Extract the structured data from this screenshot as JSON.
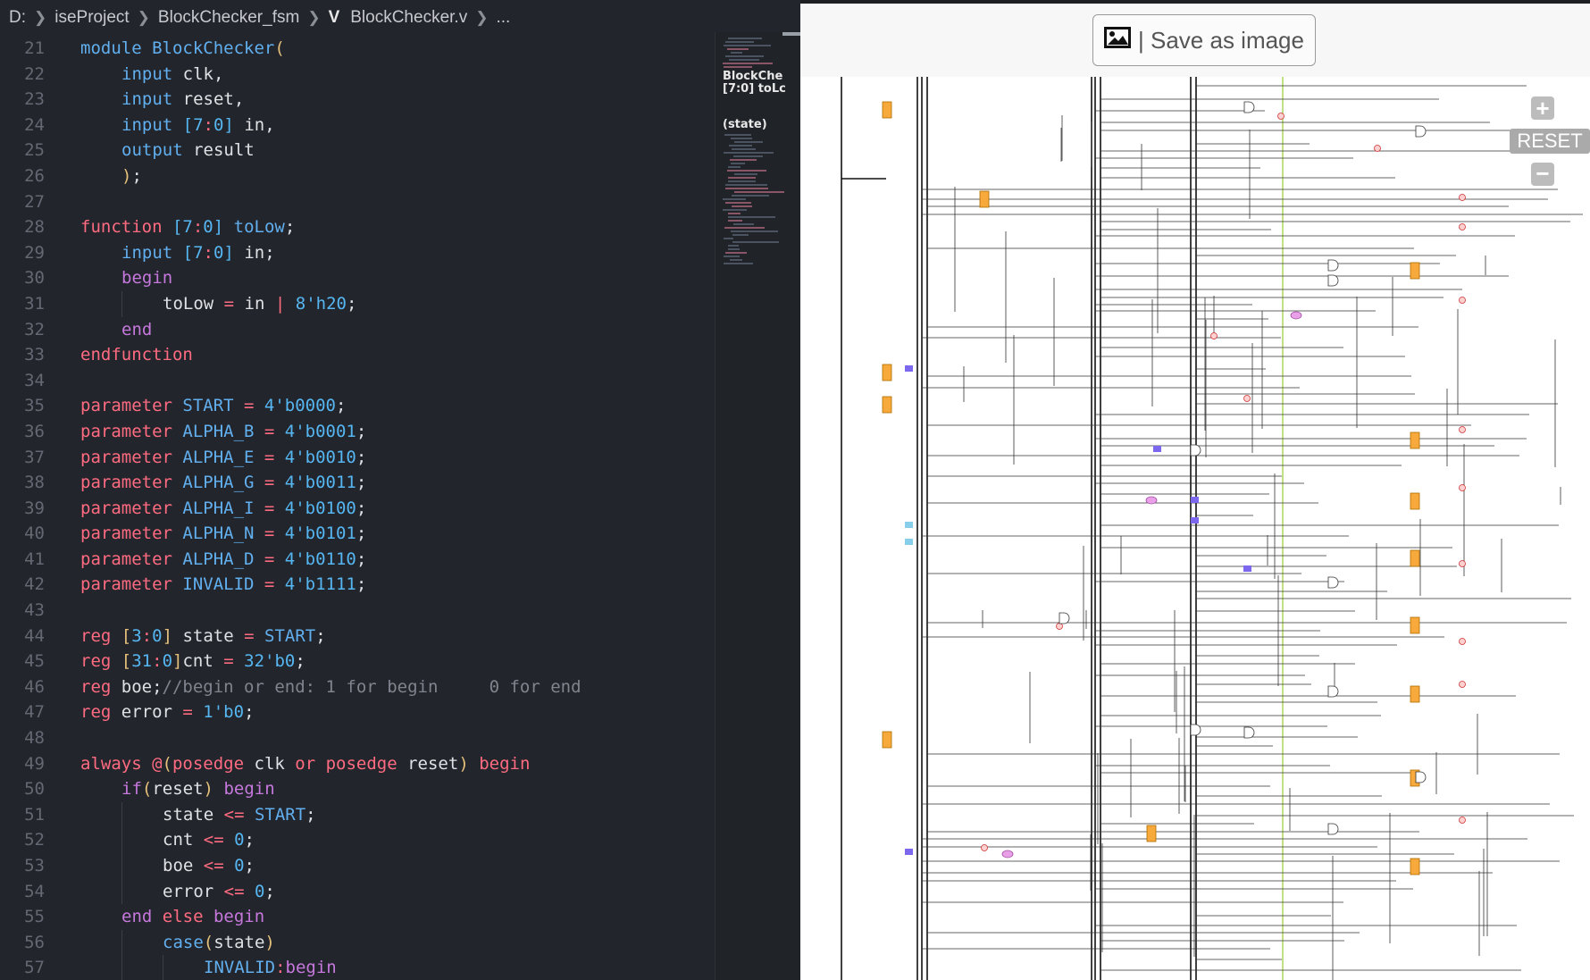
{
  "breadcrumb": {
    "items": [
      "D:",
      "iseProject",
      "BlockChecker_fsm"
    ],
    "file_icon": "V",
    "file": "BlockChecker.v",
    "tail": "..."
  },
  "code": {
    "lines": [
      {
        "n": "21",
        "i": 0,
        "t": [
          [
            "kw3",
            "module "
          ],
          [
            "fn",
            "BlockChecker"
          ],
          [
            "br",
            "("
          ]
        ]
      },
      {
        "n": "22",
        "i": 1,
        "t": [
          [
            "kw3",
            "input "
          ],
          [
            "",
            "clk,"
          ]
        ]
      },
      {
        "n": "23",
        "i": 1,
        "t": [
          [
            "kw3",
            "input "
          ],
          [
            "",
            "reset,"
          ]
        ]
      },
      {
        "n": "24",
        "i": 1,
        "t": [
          [
            "kw3",
            "input "
          ],
          [
            "num",
            "[7"
          ],
          [
            "op",
            ":"
          ],
          [
            "num",
            "0] "
          ],
          [
            "",
            "in,"
          ]
        ]
      },
      {
        "n": "25",
        "i": 1,
        "t": [
          [
            "kw3",
            "output "
          ],
          [
            "",
            "result"
          ]
        ]
      },
      {
        "n": "26",
        "i": 1,
        "t": [
          [
            "br",
            ")"
          ],
          [
            "",
            ";"
          ]
        ]
      },
      {
        "n": "27",
        "i": 0,
        "t": []
      },
      {
        "n": "28",
        "i": 0,
        "t": [
          [
            "kw2",
            "function "
          ],
          [
            "num",
            "[7"
          ],
          [
            "op",
            ":"
          ],
          [
            "num",
            "0] "
          ],
          [
            "fn",
            "toLow"
          ],
          [
            "",
            ";"
          ]
        ]
      },
      {
        "n": "29",
        "i": 1,
        "t": [
          [
            "kw3",
            "input "
          ],
          [
            "num",
            "[7"
          ],
          [
            "op",
            ":"
          ],
          [
            "num",
            "0] "
          ],
          [
            "",
            "in;"
          ]
        ]
      },
      {
        "n": "30",
        "i": 1,
        "t": [
          [
            "kw",
            "begin"
          ]
        ]
      },
      {
        "n": "31",
        "i": 2,
        "t": [
          [
            "",
            "toLow "
          ],
          [
            "op",
            "= "
          ],
          [
            "",
            "in "
          ],
          [
            "op",
            "| "
          ],
          [
            "num",
            "8'h20"
          ],
          [
            "",
            ";"
          ]
        ]
      },
      {
        "n": "32",
        "i": 1,
        "t": [
          [
            "kw",
            "end"
          ]
        ]
      },
      {
        "n": "33",
        "i": 0,
        "t": [
          [
            "kw2",
            "endfunction"
          ]
        ]
      },
      {
        "n": "34",
        "i": 0,
        "t": []
      },
      {
        "n": "35",
        "i": 0,
        "t": [
          [
            "kw2",
            "parameter "
          ],
          [
            "fn",
            "START "
          ],
          [
            "op",
            "= "
          ],
          [
            "num",
            "4'b0000"
          ],
          [
            "",
            ";"
          ]
        ]
      },
      {
        "n": "36",
        "i": 0,
        "t": [
          [
            "kw2",
            "parameter "
          ],
          [
            "fn",
            "ALPHA_B "
          ],
          [
            "op",
            "= "
          ],
          [
            "num",
            "4'b0001"
          ],
          [
            "",
            ";"
          ]
        ]
      },
      {
        "n": "37",
        "i": 0,
        "t": [
          [
            "kw2",
            "parameter "
          ],
          [
            "fn",
            "ALPHA_E "
          ],
          [
            "op",
            "= "
          ],
          [
            "num",
            "4'b0010"
          ],
          [
            "",
            ";"
          ]
        ]
      },
      {
        "n": "38",
        "i": 0,
        "t": [
          [
            "kw2",
            "parameter "
          ],
          [
            "fn",
            "ALPHA_G "
          ],
          [
            "op",
            "= "
          ],
          [
            "num",
            "4'b0011"
          ],
          [
            "",
            ";"
          ]
        ]
      },
      {
        "n": "39",
        "i": 0,
        "t": [
          [
            "kw2",
            "parameter "
          ],
          [
            "fn",
            "ALPHA_I "
          ],
          [
            "op",
            "= "
          ],
          [
            "num",
            "4'b0100"
          ],
          [
            "",
            ";"
          ]
        ]
      },
      {
        "n": "40",
        "i": 0,
        "t": [
          [
            "kw2",
            "parameter "
          ],
          [
            "fn",
            "ALPHA_N "
          ],
          [
            "op",
            "= "
          ],
          [
            "num",
            "4'b0101"
          ],
          [
            "",
            ";"
          ]
        ]
      },
      {
        "n": "41",
        "i": 0,
        "t": [
          [
            "kw2",
            "parameter "
          ],
          [
            "fn",
            "ALPHA_D "
          ],
          [
            "op",
            "= "
          ],
          [
            "num",
            "4'b0110"
          ],
          [
            "",
            ";"
          ]
        ]
      },
      {
        "n": "42",
        "i": 0,
        "t": [
          [
            "kw2",
            "parameter "
          ],
          [
            "fn",
            "INVALID "
          ],
          [
            "op",
            "= "
          ],
          [
            "num",
            "4'b1111"
          ],
          [
            "",
            ";"
          ]
        ]
      },
      {
        "n": "43",
        "i": 0,
        "t": []
      },
      {
        "n": "44",
        "i": 0,
        "t": [
          [
            "kw2",
            "reg "
          ],
          [
            "br",
            "["
          ],
          [
            "num",
            "3"
          ],
          [
            "op",
            ":"
          ],
          [
            "num",
            "0"
          ],
          [
            "br",
            "] "
          ],
          [
            "",
            "state "
          ],
          [
            "op",
            "= "
          ],
          [
            "fn",
            "START"
          ],
          [
            "",
            ";"
          ]
        ]
      },
      {
        "n": "45",
        "i": 0,
        "t": [
          [
            "kw2",
            "reg "
          ],
          [
            "br",
            "["
          ],
          [
            "num",
            "31"
          ],
          [
            "op",
            ":"
          ],
          [
            "num",
            "0"
          ],
          [
            "br",
            "]"
          ],
          [
            "",
            "cnt "
          ],
          [
            "op",
            "= "
          ],
          [
            "num",
            "32'b0"
          ],
          [
            "",
            ";"
          ]
        ]
      },
      {
        "n": "46",
        "i": 0,
        "t": [
          [
            "kw2",
            "reg "
          ],
          [
            "",
            "boe;"
          ],
          [
            "cm",
            "//begin or end: 1 for begin     0 for end"
          ]
        ]
      },
      {
        "n": "47",
        "i": 0,
        "t": [
          [
            "kw2",
            "reg "
          ],
          [
            "",
            "error "
          ],
          [
            "op",
            "= "
          ],
          [
            "num",
            "1'b0"
          ],
          [
            "",
            ";"
          ]
        ]
      },
      {
        "n": "48",
        "i": 0,
        "t": []
      },
      {
        "n": "49",
        "i": 0,
        "t": [
          [
            "kw2",
            "always "
          ],
          [
            "op",
            "@"
          ],
          [
            "br",
            "("
          ],
          [
            "kw2",
            "posedge "
          ],
          [
            "",
            "clk "
          ],
          [
            "kw2",
            "or "
          ],
          [
            "kw2",
            "posedge "
          ],
          [
            "",
            "reset"
          ],
          [
            "br",
            ") "
          ],
          [
            "kw2",
            "begin"
          ]
        ]
      },
      {
        "n": "50",
        "i": 1,
        "t": [
          [
            "kw",
            "if"
          ],
          [
            "br",
            "("
          ],
          [
            "",
            "reset"
          ],
          [
            "br",
            ") "
          ],
          [
            "kw",
            "begin"
          ]
        ]
      },
      {
        "n": "51",
        "i": 2,
        "t": [
          [
            "",
            "state "
          ],
          [
            "op",
            "<= "
          ],
          [
            "fn",
            "START"
          ],
          [
            "",
            ";"
          ]
        ]
      },
      {
        "n": "52",
        "i": 2,
        "t": [
          [
            "",
            "cnt "
          ],
          [
            "op",
            "<= "
          ],
          [
            "num",
            "0"
          ],
          [
            "",
            ";"
          ]
        ]
      },
      {
        "n": "53",
        "i": 2,
        "t": [
          [
            "",
            "boe "
          ],
          [
            "op",
            "<= "
          ],
          [
            "num",
            "0"
          ],
          [
            "",
            ";"
          ]
        ]
      },
      {
        "n": "54",
        "i": 2,
        "t": [
          [
            "",
            "error "
          ],
          [
            "op",
            "<= "
          ],
          [
            "num",
            "0"
          ],
          [
            "",
            ";"
          ]
        ]
      },
      {
        "n": "55",
        "i": 1,
        "t": [
          [
            "kw",
            "end "
          ],
          [
            "kw2",
            "else "
          ],
          [
            "kw",
            "begin"
          ]
        ]
      },
      {
        "n": "56",
        "i": 2,
        "t": [
          [
            "kw3",
            "case"
          ],
          [
            "br",
            "("
          ],
          [
            "",
            "state"
          ],
          [
            "br",
            ")"
          ]
        ]
      },
      {
        "n": "57",
        "i": 3,
        "t": [
          [
            "fn",
            "INVALID"
          ],
          [
            "op",
            ":"
          ],
          [
            "kw",
            "begin"
          ]
        ]
      }
    ]
  },
  "minimap": {
    "labels": [
      "BlockChe",
      "[7:0] toLc",
      "(state)"
    ]
  },
  "viewer": {
    "save_label": "| Save as image",
    "zoom_in": "+",
    "reset": "RESET",
    "zoom_out": "−"
  },
  "colors": {
    "editor_bg": "#22252b",
    "register": "#f7a93c",
    "port": "#7b68ee",
    "mux": "#e9a0e9"
  }
}
